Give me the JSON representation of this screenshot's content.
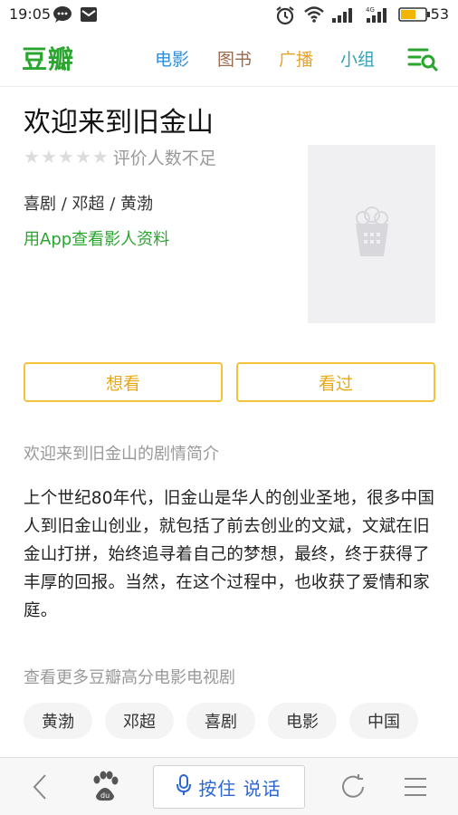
{
  "status_bar": {
    "time": "19:05",
    "battery": "53",
    "network": "4G"
  },
  "header": {
    "logo": "豆瓣",
    "nav": [
      {
        "label": "电影",
        "color": "#2e8fdc"
      },
      {
        "label": "图书",
        "color": "#9a6a4c"
      },
      {
        "label": "广播",
        "color": "#e8a32b"
      },
      {
        "label": "小组",
        "color": "#35a2b3"
      }
    ],
    "menu_icon": "menu-search-icon"
  },
  "movie": {
    "title": "欢迎来到旧金山",
    "rating_text": "评价人数不足",
    "stars": 5,
    "meta": "喜剧 / 邓超 / 黄渤",
    "app_link": "用App查看影人资料",
    "poster_icon": "popcorn-icon"
  },
  "actions": {
    "want_label": "想看",
    "seen_label": "看过"
  },
  "synopsis": {
    "heading": "欢迎来到旧金山的剧情简介",
    "text": "上个世纪80年代，旧金山是华人的创业圣地，很多中国人到旧金山创业，就包括了前去创业的文斌，文斌在旧金山打拼，始终追寻着自己的梦想，最终，终于获得了丰厚的回报。当然，在这个过程中，也收获了爱情和家庭。"
  },
  "more": {
    "heading": "查看更多豆瓣高分电影电视剧",
    "tags": [
      "黄渤",
      "邓超",
      "喜剧",
      "电影",
      "中国"
    ]
  },
  "bottom_bar": {
    "voice_label": "按住 说话"
  },
  "colors": {
    "brand_green": "#2aa52f",
    "button_border": "#f5c33a",
    "button_text": "#e9a80f",
    "voice_blue": "#2c66d4"
  }
}
